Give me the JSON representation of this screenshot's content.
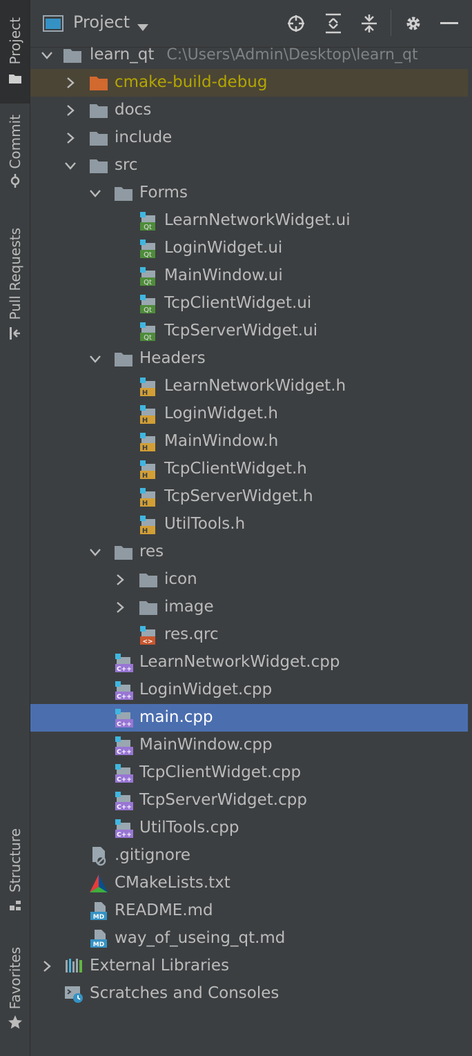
{
  "sidebar": {
    "project_label": "Project",
    "commit_label": "Commit",
    "pull_requests_label": "Pull Requests",
    "structure_label": "Structure",
    "favorites_label": "Favorites"
  },
  "header": {
    "title": "Project"
  },
  "tree": {
    "root": {
      "label": "learn_qt",
      "path": "C:\\Users\\Admin\\Desktop\\learn_qt"
    },
    "cmake_build_debug": "cmake-build-debug",
    "docs": "docs",
    "include": "include",
    "src": "src",
    "forms": "Forms",
    "forms_files": [
      "LearnNetworkWidget.ui",
      "LoginWidget.ui",
      "MainWindow.ui",
      "TcpClientWidget.ui",
      "TcpServerWidget.ui"
    ],
    "headers": "Headers",
    "header_files": [
      "LearnNetworkWidget.h",
      "LoginWidget.h",
      "MainWindow.h",
      "TcpClientWidget.h",
      "TcpServerWidget.h",
      "UtilTools.h"
    ],
    "res": "res",
    "res_icon": "icon",
    "res_image": "image",
    "res_qrc": "res.qrc",
    "cpp_files": [
      "LearnNetworkWidget.cpp",
      "LoginWidget.cpp",
      "main.cpp",
      "MainWindow.cpp",
      "TcpClientWidget.cpp",
      "TcpServerWidget.cpp",
      "UtilTools.cpp"
    ],
    "gitignore": ".gitignore",
    "cmakelists": "CMakeLists.txt",
    "readme": "README.md",
    "way_of_useing": "way_of_useing_qt.md",
    "external_libraries": "External Libraries",
    "scratches": "Scratches and Consoles"
  },
  "icons": {
    "folder": "folder-icon",
    "excluded_folder": "excluded-folder-icon",
    "qt_form": "qt-ui-file-icon",
    "header_file": "h-file-icon",
    "cpp_file": "cpp-file-icon",
    "qrc_file": "qrc-file-icon",
    "gitignore_file": "ignore-file-icon",
    "cmake_file": "cmake-icon",
    "markdown_file": "md-file-icon",
    "libraries": "libraries-icon",
    "scratches": "scratches-icon"
  },
  "colors": {
    "background": "#3c3f41",
    "selection": "#4b6eaf",
    "excluded_text": "#b3a600",
    "excluded_bg": "#4b4536",
    "text": "#bbbbbb"
  },
  "selected_item": "main.cpp"
}
